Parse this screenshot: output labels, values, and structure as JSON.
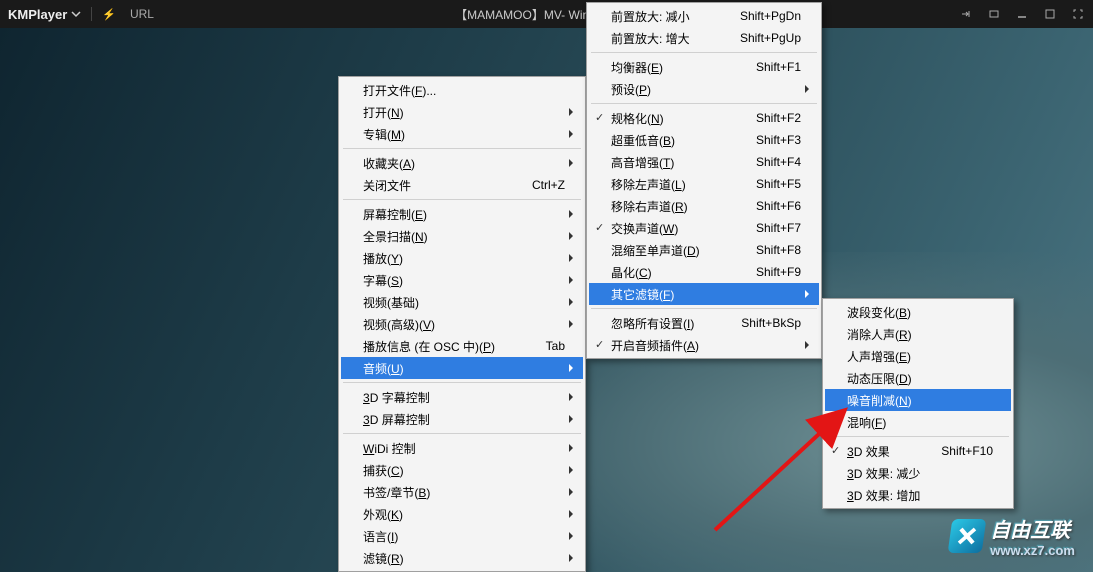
{
  "title_bar": {
    "app_name": "KMPlayer",
    "bolt": "⚡",
    "url_label": "URL",
    "video_title": "【MAMAMOO】MV- Wind Flower."
  },
  "watermark": {
    "text": "自由互联",
    "url": "www.xz7.com"
  },
  "menu1": {
    "items": [
      {
        "label": "打开文件(F)...",
        "arrow": false
      },
      {
        "label": "打开(N)",
        "arrow": true
      },
      {
        "label": "专辑(M)",
        "arrow": true
      },
      {
        "sep": true
      },
      {
        "label": "收藏夹(A)",
        "arrow": true
      },
      {
        "label": "关闭文件",
        "hk": "Ctrl+Z"
      },
      {
        "sep": true
      },
      {
        "label": "屏幕控制(E)",
        "arrow": true
      },
      {
        "label": "全景扫描(N)",
        "arrow": true
      },
      {
        "label": "播放(Y)",
        "arrow": true
      },
      {
        "label": "字幕(S)",
        "arrow": true
      },
      {
        "label": "视频(基础)",
        "arrow": true
      },
      {
        "label": "视频(高级)(V)",
        "arrow": true
      },
      {
        "label": "播放信息 (在 OSC 中)(P)",
        "hk": "Tab"
      },
      {
        "label": "音频(U)",
        "arrow": true,
        "highlight": true
      },
      {
        "sep": true
      },
      {
        "label": "3D 字幕控制",
        "arrow": true
      },
      {
        "label": "3D 屏幕控制",
        "arrow": true
      },
      {
        "sep": true
      },
      {
        "label": "WiDi 控制",
        "arrow": true
      },
      {
        "label": "捕获(C)",
        "arrow": true
      },
      {
        "label": "书签/章节(B)",
        "arrow": true
      },
      {
        "label": "外观(K)",
        "arrow": true
      },
      {
        "label": "语言(I)",
        "arrow": true
      },
      {
        "label": "滤镜(R)",
        "arrow": true
      }
    ]
  },
  "menu2": {
    "items": [
      {
        "label": "前置放大: 减小",
        "hk": "Shift+PgDn"
      },
      {
        "label": "前置放大: 增大",
        "hk": "Shift+PgUp"
      },
      {
        "sep": true
      },
      {
        "label": "均衡器(E)",
        "hk": "Shift+F1"
      },
      {
        "label": "预设(P)",
        "arrow": true
      },
      {
        "sep": true
      },
      {
        "label": "规格化(N)",
        "hk": "Shift+F2",
        "checked": true
      },
      {
        "label": "超重低音(B)",
        "hk": "Shift+F3"
      },
      {
        "label": "高音增强(T)",
        "hk": "Shift+F4"
      },
      {
        "label": "移除左声道(L)",
        "hk": "Shift+F5"
      },
      {
        "label": "移除右声道(R)",
        "hk": "Shift+F6"
      },
      {
        "label": "交换声道(W)",
        "hk": "Shift+F7",
        "checked": true
      },
      {
        "label": "混缩至单声道(D)",
        "hk": "Shift+F8"
      },
      {
        "label": "晶化(C)",
        "hk": "Shift+F9"
      },
      {
        "label": "其它滤镜(F)",
        "arrow": true,
        "highlight": true
      },
      {
        "sep": true
      },
      {
        "label": "忽略所有设置(I)",
        "hk": "Shift+BkSp"
      },
      {
        "label": "开启音频插件(A)",
        "arrow": true,
        "checked": true
      }
    ]
  },
  "menu3": {
    "items": [
      {
        "label": "波段变化(B)"
      },
      {
        "label": "消除人声(R)"
      },
      {
        "label": "人声增强(E)"
      },
      {
        "label": "动态压限(D)"
      },
      {
        "label": "噪音削减(N)",
        "highlight": true
      },
      {
        "label": "混响(F)"
      },
      {
        "sep": true
      },
      {
        "label": "3D 效果",
        "hk": "Shift+F10",
        "checked": true
      },
      {
        "label": "3D 效果: 减少"
      },
      {
        "label": "3D 效果: 增加"
      }
    ]
  }
}
